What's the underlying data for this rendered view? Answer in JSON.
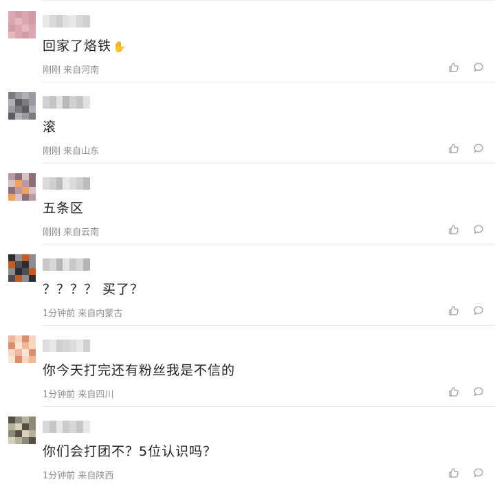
{
  "comments": [
    {
      "text": "回家了烙铁",
      "meta": "刚刚 来自河南",
      "has_emoji": true,
      "avatar_colors": [
        "#dca7ae",
        "#d49aa6",
        "#d9a7af",
        "#e4b8bd"
      ],
      "name_colors": [
        "#e8e8e8",
        "#d9d9d9",
        "#cfcfcf",
        "#e1e1e1"
      ]
    },
    {
      "text": "滚",
      "meta": "刚刚 来自山东",
      "has_emoji": false,
      "avatar_colors": [
        "#7b7b7f",
        "#9a9aa1",
        "#aeb1b7",
        "#5b5c62"
      ],
      "name_colors": [
        "#d0d0d0",
        "#c4c4c4",
        "#e1e1e1",
        "#b9b9b9"
      ]
    },
    {
      "text": "五条区",
      "meta": "刚刚 来自云南",
      "has_emoji": false,
      "avatar_colors": [
        "#b89ba2",
        "#8d6f77",
        "#d8c2c5",
        "#f0a05a"
      ],
      "name_colors": [
        "#dbdbdb",
        "#cfcfcf",
        "#bcbcbc",
        "#e8e8e8"
      ]
    },
    {
      "text": "？？？？ 买了？",
      "meta": "1分钟前 来自内蒙古",
      "has_emoji": false,
      "avatar_colors": [
        "#2c2d31",
        "#8c8d91",
        "#c45a24",
        "#4e4f55"
      ],
      "name_colors": [
        "#c8c8c8",
        "#d7d7d7",
        "#b5b5b5",
        "#e3e3e3"
      ]
    },
    {
      "text": "你今天打完还有粉丝我是不信的",
      "meta": "1分钟前 来自四川",
      "has_emoji": false,
      "avatar_colors": [
        "#f1b79a",
        "#f8d6c2",
        "#d98f6b",
        "#f7e5d8"
      ],
      "name_colors": [
        "#dddddd",
        "#e8e8e8",
        "#cfcfcf",
        "#d5d5d5"
      ]
    },
    {
      "text": "你们会打团不？5位认识吗？",
      "meta": "1分钟前 来自陕西",
      "has_emoji": false,
      "avatar_colors": [
        "#545142",
        "#8d8a77",
        "#b7b29b",
        "#d7d0bb"
      ],
      "name_colors": [
        "#d8d8d8",
        "#c7c7c7",
        "#e7e7e7",
        "#cccccc"
      ]
    }
  ],
  "icons": {
    "like": "thumbs-up-icon",
    "reply": "comment-bubble-icon",
    "emoji": "hand-emoji-icon"
  },
  "colors": {
    "text": "#222222",
    "meta": "#8d8d8d",
    "icon": "#9a9a9a",
    "separator": "#e9e9e9"
  }
}
